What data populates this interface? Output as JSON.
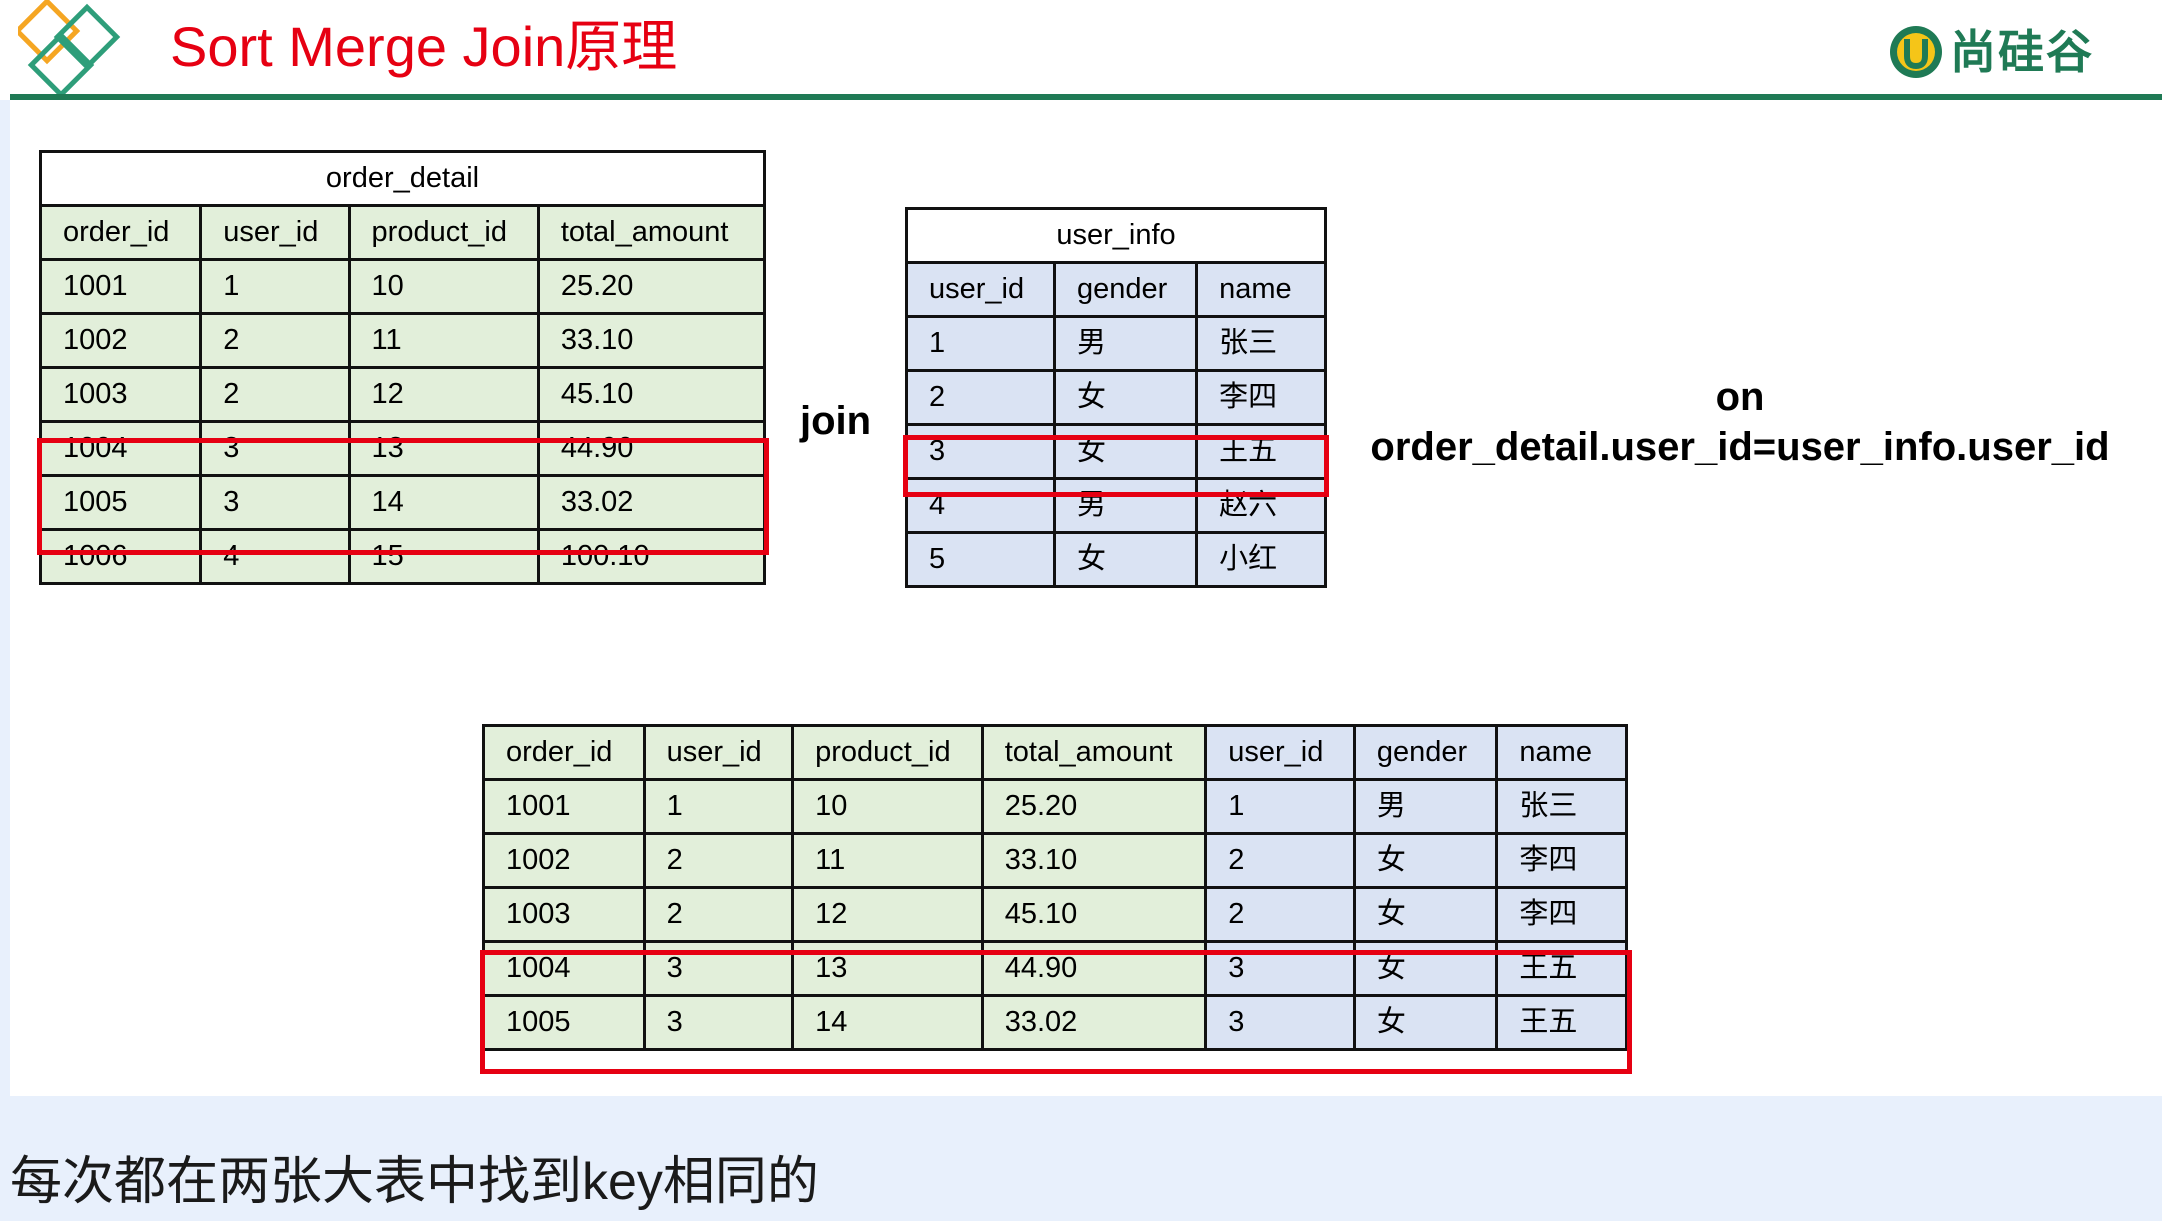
{
  "header": {
    "title": "Sort Merge Join原理",
    "brand": "尚硅谷",
    "colors": {
      "title": "#e60012",
      "brand": "#1f7a55",
      "rule": "#1f7a55",
      "highlight": "#e60012",
      "diamond_orange": "#f5a623",
      "diamond_green": "#2e9e7a"
    }
  },
  "order_detail": {
    "name": "order_detail",
    "columns": [
      "order_id",
      "user_id",
      "product_id",
      "total_amount"
    ],
    "rows": [
      [
        "1001",
        "1",
        "10",
        "25.20"
      ],
      [
        "1002",
        "2",
        "11",
        "33.10"
      ],
      [
        "1003",
        "2",
        "12",
        "45.10"
      ],
      [
        "1004",
        "3",
        "13",
        "44.90"
      ],
      [
        "1005",
        "3",
        "14",
        "33.02"
      ],
      [
        "1006",
        "4",
        "15",
        "100.10"
      ]
    ],
    "highlighted_rows": [
      "1004",
      "1005"
    ],
    "fill": "#e2efda"
  },
  "join_word": "join",
  "user_info": {
    "name": "user_info",
    "columns": [
      "user_id",
      "gender",
      "name"
    ],
    "rows": [
      [
        "1",
        "男",
        "张三"
      ],
      [
        "2",
        "女",
        "李四"
      ],
      [
        "3",
        "女",
        "王五"
      ],
      [
        "4",
        "男",
        "赵六"
      ],
      [
        "5",
        "女",
        "小红"
      ]
    ],
    "highlighted_rows": [
      "3"
    ],
    "fill": "#dae3f3"
  },
  "on_clause": {
    "keyword": "on",
    "condition": "order_detail.user_id=user_info.user_id"
  },
  "result": {
    "columns": [
      "order_id",
      "user_id",
      "product_id",
      "total_amount",
      "user_id",
      "gender",
      "name"
    ],
    "rows": [
      [
        "1001",
        "1",
        "10",
        "25.20",
        "1",
        "男",
        "张三"
      ],
      [
        "1002",
        "2",
        "11",
        "33.10",
        "2",
        "女",
        "李四"
      ],
      [
        "1003",
        "2",
        "12",
        "45.10",
        "2",
        "女",
        "李四"
      ],
      [
        "1004",
        "3",
        "13",
        "44.90",
        "3",
        "女",
        "王五"
      ],
      [
        "1005",
        "3",
        "14",
        "33.02",
        "3",
        "女",
        "王五"
      ]
    ],
    "highlighted_rows": [
      "1004",
      "1005"
    ]
  },
  "footer": {
    "text": "每次都在两张大表中找到key相同的"
  }
}
